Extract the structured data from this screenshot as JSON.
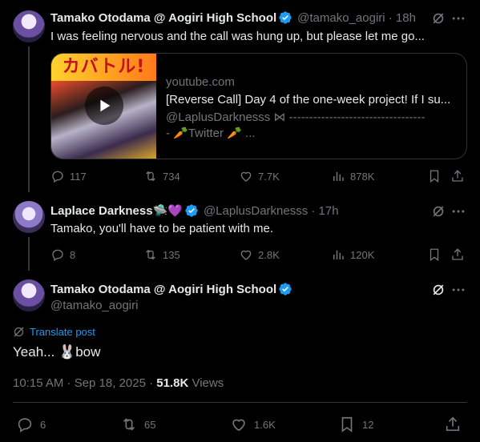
{
  "tweet1": {
    "name": "Tamako Otodama @ Aogiri High School",
    "handle_time": "@tamako_aogiri · 18h",
    "text": "I was feeling nervous and the call was hung up, but please let me go...",
    "card": {
      "thumb_title": "カバトル!",
      "domain": "youtube.com",
      "title": "[Reverse Call] Day 4 of the one-week project! If I su...",
      "desc1": "@LaplusDarknesss ⋈ ----------------------------------",
      "desc2": "- 🥕Twitter 🥕 ..."
    },
    "actions": {
      "replies": "117",
      "reposts": "734",
      "likes": "7.7K",
      "views": "878K"
    }
  },
  "tweet2": {
    "name": "Laplace Darkness🛸💜",
    "handle_time": "@LaplusDarknesss · 17h",
    "text": "Tamako, you'll have to be patient with me.",
    "actions": {
      "replies": "8",
      "reposts": "135",
      "likes": "2.8K",
      "views": "120K"
    }
  },
  "main": {
    "name": "Tamako Otodama @ Aogiri High School",
    "handle": "@tamako_aogiri",
    "translate": "Translate post",
    "text": "Yeah... 🐰bow",
    "timestamp": "10:15 AM · Sep 18, 2025 · ",
    "views_count": "51.8K",
    "views_label": " Views",
    "actions": {
      "replies": "6",
      "reposts": "65",
      "likes": "1.6K",
      "bookmarks": "12"
    }
  },
  "colors": {
    "accent": "#1d9bf0",
    "muted": "#71767b",
    "text": "#e7e9ea",
    "border": "#2f3336"
  }
}
